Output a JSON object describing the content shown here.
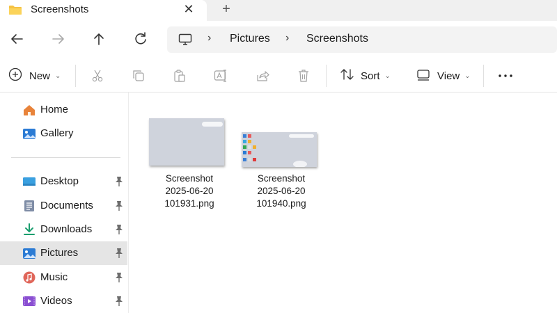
{
  "tab": {
    "title": "Screenshots"
  },
  "breadcrumb": [
    "Pictures",
    "Screenshots"
  ],
  "commands": {
    "new_label": "New",
    "sort_label": "Sort",
    "view_label": "View"
  },
  "sidebar": {
    "items": [
      {
        "label": "Home"
      },
      {
        "label": "Gallery"
      },
      {
        "label": "Desktop"
      },
      {
        "label": "Documents"
      },
      {
        "label": "Downloads"
      },
      {
        "label": "Pictures"
      },
      {
        "label": "Music"
      },
      {
        "label": "Videos"
      }
    ],
    "selected": "Pictures"
  },
  "files": [
    {
      "line1": "Screenshot",
      "line2": "2025-06-20",
      "line3": "101931.png"
    },
    {
      "line1": "Screenshot",
      "line2": "2025-06-20",
      "line3": "101940.png"
    }
  ],
  "colors": {
    "folder": "#f5c244",
    "accent": "#0067c0",
    "selected_bg": "#e5e5e5"
  }
}
